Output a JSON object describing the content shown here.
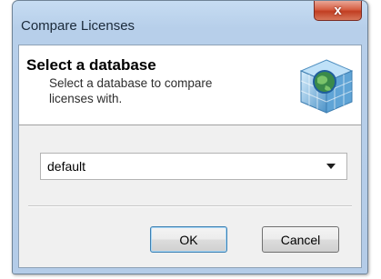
{
  "window": {
    "title": "Compare Licenses",
    "close_glyph": "x"
  },
  "header": {
    "title": "Select a database",
    "description": "Select a database to compare licenses with.",
    "icon": "database-globe-icon"
  },
  "database_select": {
    "value": "default"
  },
  "buttons": {
    "ok_label": "OK",
    "cancel_label": "Cancel"
  }
}
